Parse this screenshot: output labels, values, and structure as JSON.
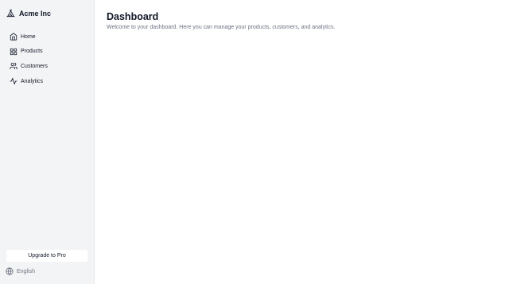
{
  "sidebar": {
    "brand": {
      "name": "Acme Inc",
      "icon": "tent-icon"
    },
    "items": [
      {
        "label": "Home",
        "icon": "home-icon"
      },
      {
        "label": "Products",
        "icon": "grid-icon"
      },
      {
        "label": "Customers",
        "icon": "users-icon"
      },
      {
        "label": "Analytics",
        "icon": "activity-icon"
      }
    ],
    "upgrade_label": "Upgrade to Pro",
    "language": {
      "label": "English",
      "icon": "globe-icon"
    }
  },
  "main": {
    "title": "Dashboard",
    "subtitle": "Welcome to your dashboard. Here you can manage your products, customers, and analytics."
  },
  "colors": {
    "sidebar_bg": "#f3f4f6",
    "text": "#111827",
    "muted_text": "#6b7280"
  }
}
